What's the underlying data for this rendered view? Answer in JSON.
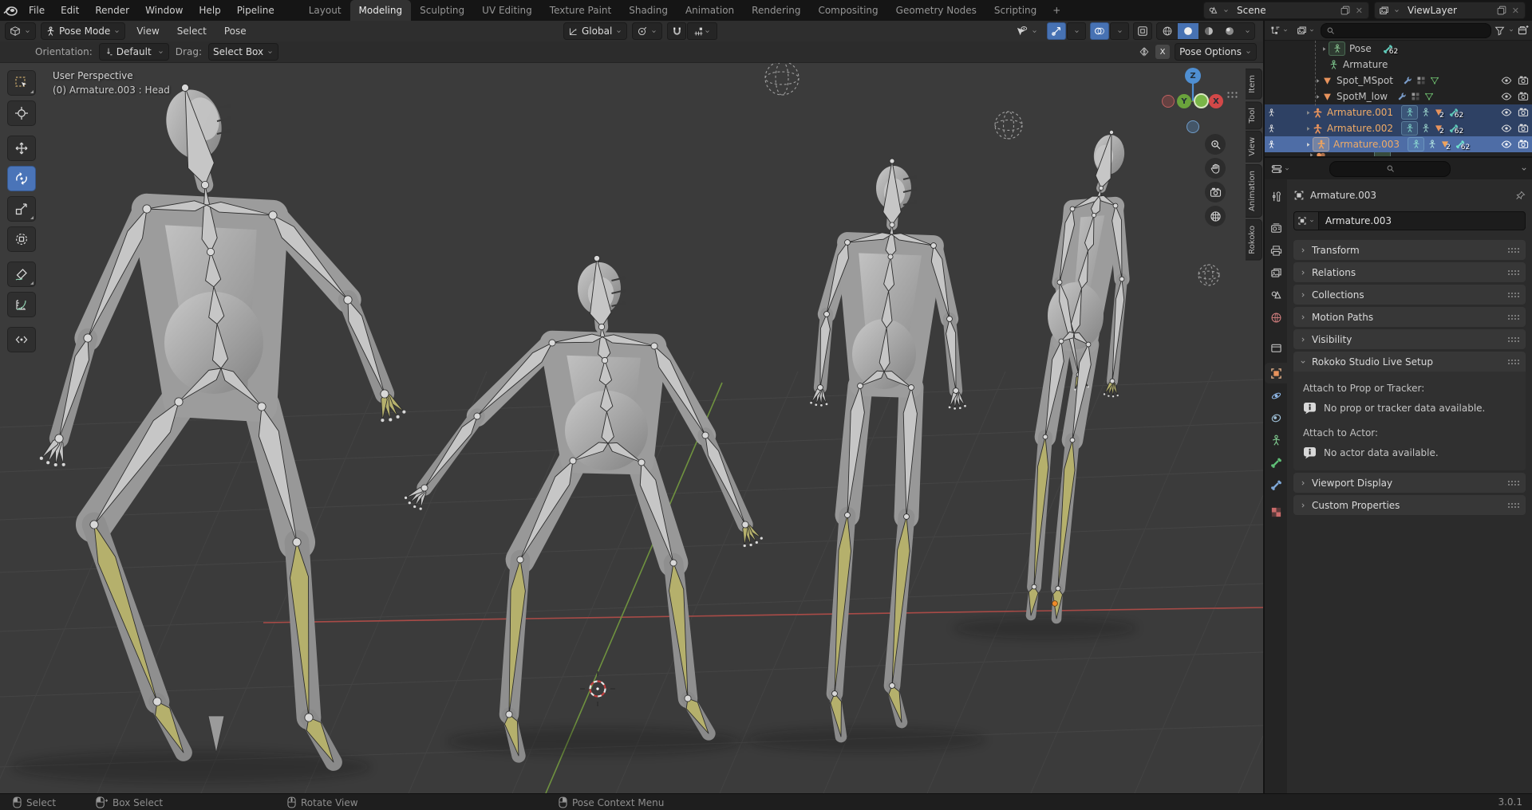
{
  "app": {
    "name": "Blender",
    "version": "3.0.1"
  },
  "colors": {
    "accent_blue": "#4772b3",
    "selected_row_blue": "#2e4164",
    "active_row_blue": "#4e6da6",
    "armature_text_orange": "#f0ab66",
    "selected_bone_yellow": "#b5b06c",
    "axis_x_red": "#a94b47",
    "axis_y_green": "#6f923f",
    "axis_z_blue": "#4f8fd2",
    "viewport_bg": "#3b3b3b"
  },
  "icons": {
    "search": "magnifier",
    "dropdown": "chevron-down",
    "expand": "caret-right",
    "eye": "eye",
    "camera": "camera",
    "wrench": "wrench",
    "filter": "funnel",
    "pin": "pin",
    "info": "speech-bubble-i",
    "bone": "bone",
    "armature": "stick-figure",
    "mesh": "triangle",
    "mouse_left": "mouse-lmb",
    "mouse_middle": "mouse-mmb",
    "mouse_right": "mouse-rmb"
  },
  "topbar": {
    "menus": [
      "File",
      "Edit",
      "Render",
      "Window",
      "Help",
      "Pipeline"
    ],
    "workspaces": [
      "Layout",
      "Modeling",
      "Sculpting",
      "UV Editing",
      "Texture Paint",
      "Shading",
      "Animation",
      "Rendering",
      "Compositing",
      "Geometry Nodes",
      "Scripting"
    ],
    "active_workspace": "Modeling",
    "new_workspace": "+",
    "scene_selector": {
      "value": "Scene"
    },
    "view_layer_selector": {
      "value": "ViewLayer"
    }
  },
  "viewport": {
    "header": {
      "mode_selector": "Pose Mode",
      "menus": [
        "View",
        "Select",
        "Pose"
      ],
      "transform_orientation": "Global",
      "mirror_x": "X",
      "pose_options": "Pose Options"
    },
    "tool_settings": {
      "orientation_label": "Orientation:",
      "orientation_value": "Default",
      "drag_label": "Drag:",
      "drag_value": "Select Box"
    },
    "info_overlay": {
      "line1": "User Perspective",
      "line2": "(0) Armature.003 : Head"
    },
    "sidebar_tabs": [
      "Item",
      "Tool",
      "View",
      "Animation",
      "Rokoko"
    ],
    "axis_gizmo": {
      "z": "Z",
      "y": "Y",
      "x": "X"
    },
    "toolbar_tools": [
      "Select Box",
      "Cursor",
      "Move",
      "Rotate",
      "Scale",
      "Transform",
      "Annotate",
      "Measure",
      "Breakdowner"
    ],
    "active_tool": "Rotate"
  },
  "outliner": {
    "rows": [
      {
        "label": "Pose",
        "bone_badge": "62"
      },
      {
        "label": "Armature"
      },
      {
        "label": "Spot_MSpot"
      },
      {
        "label": "SpotM_low"
      },
      {
        "label": "Armature.001",
        "mesh_badge": "2",
        "bone_badge": "62"
      },
      {
        "label": "Armature.002",
        "mesh_badge": "2",
        "bone_badge": "62"
      },
      {
        "label": "Armature.003",
        "mesh_badge": "2",
        "bone_badge": "62"
      }
    ]
  },
  "properties": {
    "breadcrumb": "Armature.003",
    "name_field": "Armature.003",
    "panels": [
      {
        "label": "Transform"
      },
      {
        "label": "Relations"
      },
      {
        "label": "Collections"
      },
      {
        "label": "Motion Paths"
      },
      {
        "label": "Visibility"
      },
      {
        "label": "Rokoko Studio Live Setup"
      },
      {
        "label": "Viewport Display"
      },
      {
        "label": "Custom Properties"
      }
    ],
    "rokoko": {
      "prop_section_label": "Attach to Prop or Tracker:",
      "prop_info": "No prop or tracker data available.",
      "actor_section_label": "Attach to Actor:",
      "actor_info": "No actor data available."
    }
  },
  "statusbar": {
    "hints": [
      {
        "label": "Select"
      },
      {
        "label": "Box Select"
      },
      {
        "label": "Rotate View"
      },
      {
        "label": "Pose Context Menu"
      }
    ],
    "version": "3.0.1"
  }
}
